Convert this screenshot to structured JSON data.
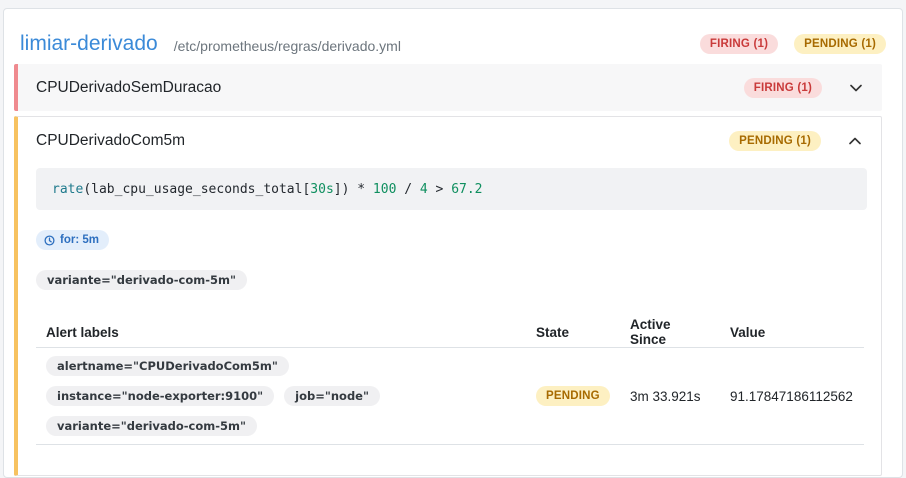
{
  "group": {
    "title": "limiar-derivado",
    "path": "/etc/prometheus/regras/derivado.yml",
    "badges": {
      "firing": "FIRING (1)",
      "pending": "PENDING (1)"
    }
  },
  "rules": [
    {
      "name": "CPUDerivadoSemDuracao",
      "badge": "FIRING (1)",
      "expanded": false
    },
    {
      "name": "CPUDerivadoCom5m",
      "badge": "PENDING (1)",
      "expanded": true,
      "expr_tokens": {
        "fn": "rate",
        "open": "(",
        "metric": "lab_cpu_usage_seconds_total[",
        "range": "30s",
        "close": "])",
        "mul": " * ",
        "n100": "100",
        "div": " / ",
        "n4": "4",
        "gt": " > ",
        "threshold": "67.2"
      },
      "for": "for: 5m",
      "labels": [
        "variante=\"derivado-com-5m\""
      ],
      "table": {
        "headers": {
          "labels": "Alert labels",
          "state": "State",
          "since": "Active Since",
          "value": "Value"
        },
        "rows": [
          {
            "labels": [
              "alertname=\"CPUDerivadoCom5m\"",
              "instance=\"node-exporter:9100\"",
              "job=\"node\"",
              "variante=\"derivado-com-5m\""
            ],
            "state": "PENDING",
            "active_since": "3m 33.921s",
            "value": "91.17847186112562"
          }
        ]
      }
    }
  ],
  "colors": {
    "firing": "#c93a3a",
    "pending": "#a76a00",
    "accent": "#3b8ad8"
  },
  "icons": {
    "collapsed": "chevron-down-icon",
    "expanded": "chevron-up-icon",
    "for": "clock-icon"
  }
}
